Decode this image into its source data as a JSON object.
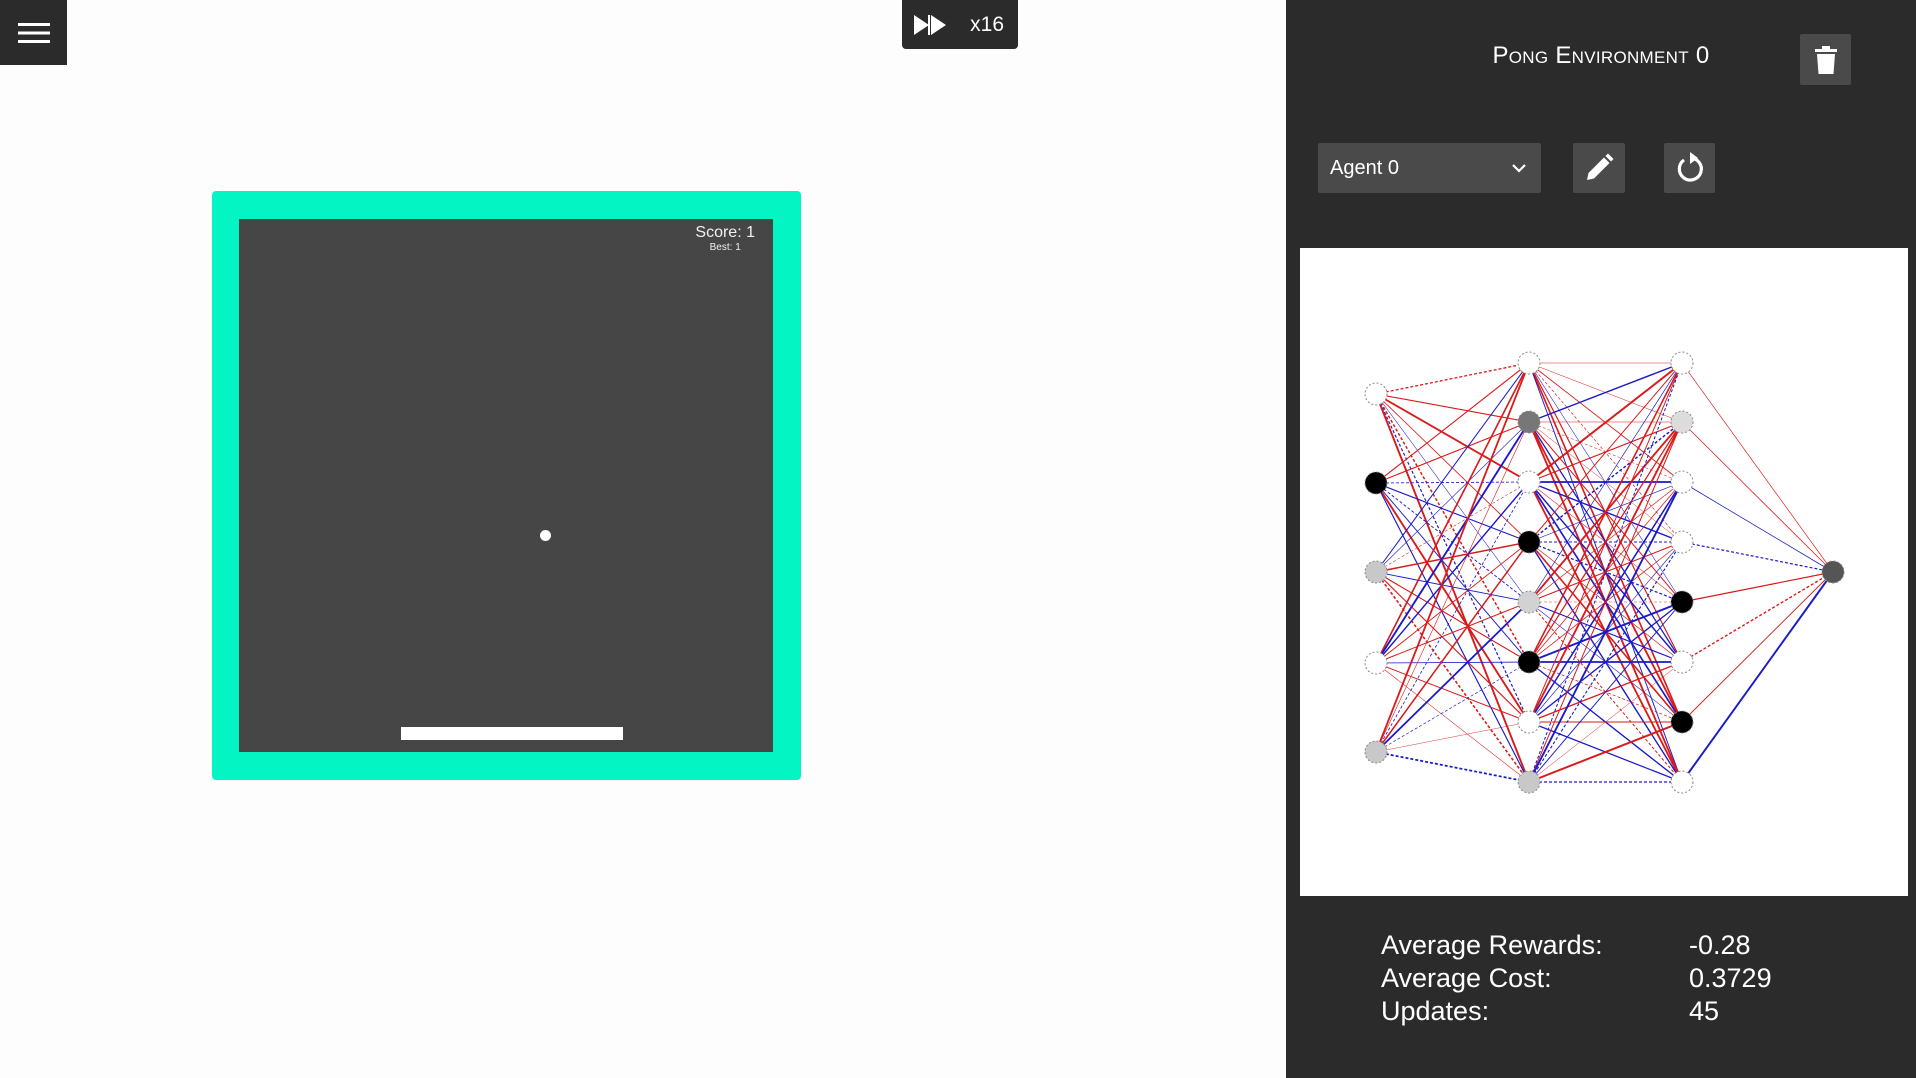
{
  "app": {
    "speed_label": "x16"
  },
  "icons": {
    "menu": "hamburger-menu-icon",
    "speed": "fast-forward-icon",
    "trash": "trash-icon",
    "edit": "pencil-icon",
    "reset": "refresh-icon",
    "dropdown": "chevron-down-icon"
  },
  "game": {
    "score_label": "Score: 1",
    "best_label": "Best: 1",
    "frame_color": "#04f5c4",
    "background_color": "#464646"
  },
  "panel": {
    "title": "Pong Environment 0",
    "agent_selected": "Agent 0"
  },
  "network": {
    "layers": [
      [
        "#ffffff",
        "#000000",
        "#c8c8c8",
        "#ffffff",
        "#c8c8c8"
      ],
      [
        "#ffffff",
        "#777777",
        "#ffffff",
        "#000000",
        "#d2d2d2",
        "#000000",
        "#ffffff",
        "#c8c8c8"
      ],
      [
        "#ffffff",
        "#dcdcdc",
        "#ffffff",
        "#ffffff",
        "#000000",
        "#ffffff",
        "#000000",
        "#ffffff"
      ],
      [
        "#555555"
      ]
    ],
    "colors": {
      "positive": "#d91a1a",
      "negative": "#1a1ac8"
    }
  },
  "stats": [
    {
      "label": "Average Rewards:",
      "value": "-0.28"
    },
    {
      "label": "Average Cost:",
      "value": "0.3729"
    },
    {
      "label": "Updates:",
      "value": "45"
    }
  ]
}
